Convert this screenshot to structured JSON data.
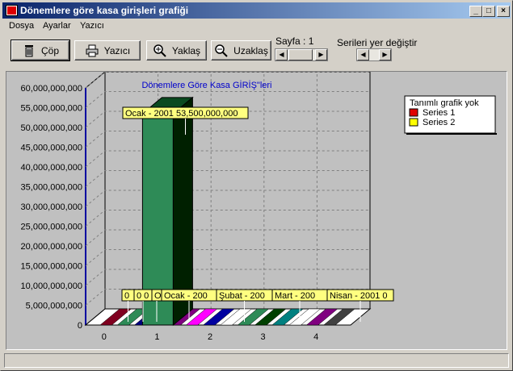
{
  "window": {
    "title": "Dönemlere göre kasa girişleri grafiği",
    "accent": "#0a246a"
  },
  "menu": {
    "items": [
      "Dosya",
      "Ayarlar",
      "Yazıcı"
    ]
  },
  "toolbar": {
    "buttons": [
      {
        "label": "Çöp",
        "icon": "trash-icon"
      },
      {
        "label": "Yazıcı",
        "icon": "printer-icon"
      },
      {
        "label": "Yaklaş",
        "icon": "zoom-in-icon"
      },
      {
        "label": "Uzaklaş",
        "icon": "zoom-out-icon"
      }
    ],
    "page_label": "Sayfa : 1",
    "swap_label": "Serileri yer değiştir"
  },
  "chart_data": {
    "type": "bar",
    "title": "Dönemlere Göre Kasa GİRİŞ\"leri",
    "categories": [
      "0",
      "1",
      "2",
      "3",
      "4"
    ],
    "ylim": [
      0,
      60000000000
    ],
    "yticks": [
      "0",
      "5,000,000,000",
      "10,000,000,000",
      "15,000,000,000",
      "20,000,000,000",
      "25,000,000,000",
      "30,000,000,000",
      "35,000,000,000",
      "40,000,000,000",
      "45,000,000,000",
      "50,000,000,000",
      "55,000,000,000",
      "60,000,000,000"
    ],
    "series": [
      {
        "name": "Tanımlı grafik yok",
        "values": [
          0,
          53500000000,
          0,
          0,
          0
        ],
        "color": "#2e8b57"
      },
      {
        "name": "Series 1",
        "values": [
          0,
          0,
          0,
          0,
          0
        ],
        "color": "#e00000"
      },
      {
        "name": "Series 2",
        "values": [
          0,
          0,
          0,
          0,
          0
        ],
        "color": "#ffff00"
      }
    ],
    "data_labels": [
      "0",
      "0 0",
      "Ocak    - 2001 53,500,000,000",
      "Ocak    - 200",
      "Şubat    - 200",
      "Mart    - 200",
      "Nisan    - 2001 0"
    ],
    "grid": true,
    "legend": "top-right"
  }
}
